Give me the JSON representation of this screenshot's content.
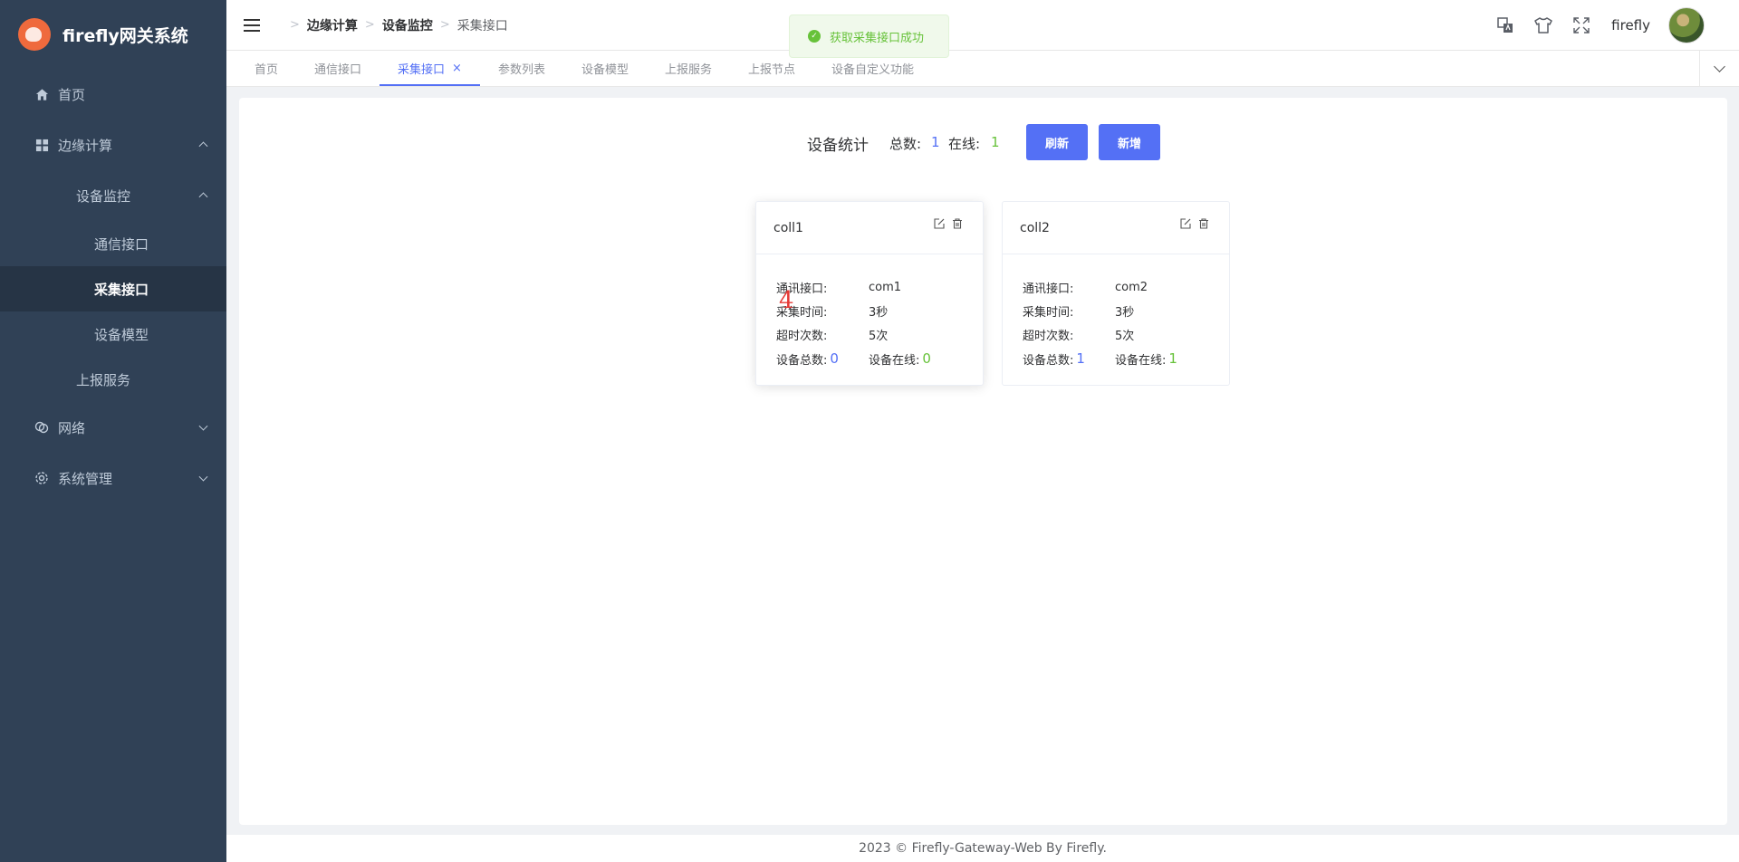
{
  "app": {
    "title": "firefly网关系统"
  },
  "sidebar": {
    "items": [
      {
        "label": "首页"
      },
      {
        "label": "边缘计算"
      },
      {
        "label": "设备监控"
      },
      {
        "label": "通信接口"
      },
      {
        "label": "采集接口"
      },
      {
        "label": "设备模型"
      },
      {
        "label": "上报服务"
      },
      {
        "label": "网络"
      },
      {
        "label": "系统管理"
      }
    ]
  },
  "breadcrumb": [
    "边缘计算",
    "设备监控",
    "采集接口"
  ],
  "header": {
    "username": "firefly"
  },
  "toast": {
    "message": "获取采集接口成功"
  },
  "tabs": [
    {
      "label": "首页"
    },
    {
      "label": "通信接口"
    },
    {
      "label": "采集接口"
    },
    {
      "label": "参数列表"
    },
    {
      "label": "设备模型"
    },
    {
      "label": "上报服务"
    },
    {
      "label": "上报节点"
    },
    {
      "label": "设备自定义功能"
    }
  ],
  "stats": {
    "title": "设备统计",
    "total_label": "总数:",
    "total": "1",
    "online_label": "在线:",
    "online": "1",
    "refresh_label": "刷新",
    "add_label": "新增"
  },
  "cards": [
    {
      "name": "coll1",
      "comm_label": "通讯接口:",
      "comm": "com1",
      "time_label": "采集时间:",
      "time": "3秒",
      "timeout_label": "超时次数:",
      "timeout": "5次",
      "total_label": "设备总数:",
      "total": "0",
      "online_label": "设备在线:",
      "online": "0"
    },
    {
      "name": "coll2",
      "comm_label": "通讯接口:",
      "comm": "com2",
      "time_label": "采集时间:",
      "time": "3秒",
      "timeout_label": "超时次数:",
      "timeout": "5次",
      "total_label": "设备总数:",
      "total": "1",
      "online_label": "设备在线:",
      "online": "1"
    }
  ],
  "marker": "4",
  "footer": {
    "text": "2023 © Firefly-Gateway-Web By Firefly."
  },
  "colors": {
    "primary": "#5470f5",
    "success": "#67c23a",
    "sidebar": "#304156"
  }
}
